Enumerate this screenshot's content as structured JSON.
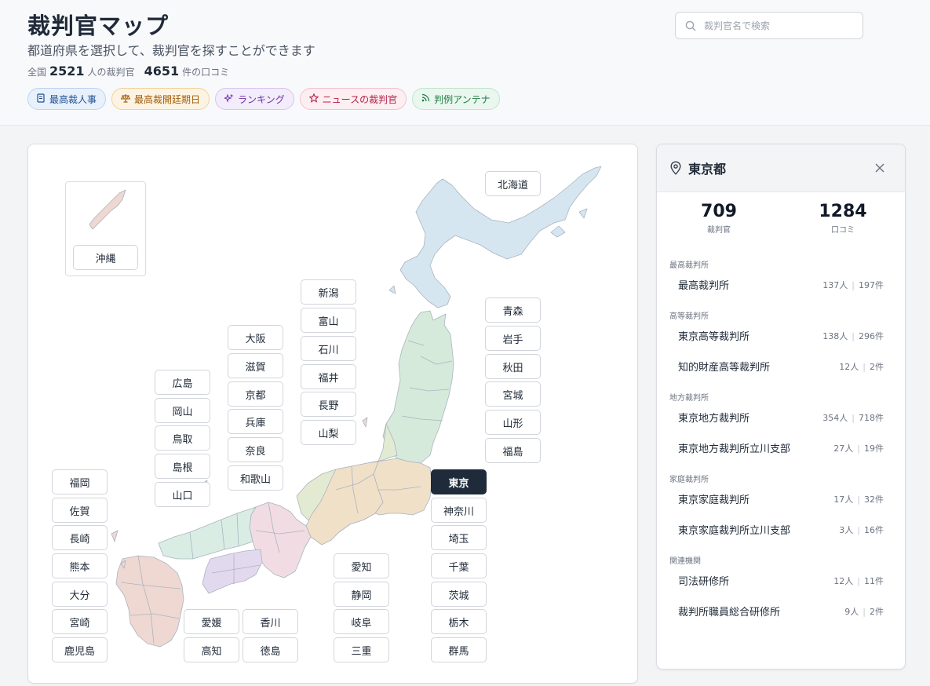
{
  "header": {
    "title": "裁判官マップ",
    "subtitle": "都道府県を選択して、裁判官を探すことができます",
    "stats": {
      "prefix": "全国",
      "judges_count": "2521",
      "judges_suffix": "人の裁判官",
      "reviews_count": "4651",
      "reviews_suffix": "件の口コミ"
    },
    "search_placeholder": "裁判官名で検索",
    "chips": [
      {
        "label": "最高裁人事",
        "icon": "document-icon"
      },
      {
        "label": "最高裁開廷期日",
        "icon": "scale-icon"
      },
      {
        "label": "ランキング",
        "icon": "sparkle-icon"
      },
      {
        "label": "ニュースの裁判官",
        "icon": "star-icon"
      },
      {
        "label": "判例アンテナ",
        "icon": "rss-icon"
      }
    ]
  },
  "map": {
    "selected": "東京",
    "prefectures": {
      "okinawa": "沖縄",
      "hokkaido": "北海道",
      "niigata": "新潟",
      "toyama": "富山",
      "ishikawa": "石川",
      "fukui": "福井",
      "nagano": "長野",
      "yamanashi": "山梨",
      "osaka": "大阪",
      "shiga": "滋賀",
      "kyoto": "京都",
      "hyogo": "兵庫",
      "nara": "奈良",
      "wakayama": "和歌山",
      "hiroshima": "広島",
      "okayama": "岡山",
      "tottori": "鳥取",
      "shimane": "島根",
      "yamaguchi": "山口",
      "aomori": "青森",
      "iwate": "岩手",
      "akita": "秋田",
      "miyagi": "宮城",
      "yamagata": "山形",
      "fukushima": "福島",
      "tokyo": "東京",
      "kanagawa": "神奈川",
      "saitama": "埼玉",
      "chiba": "千葉",
      "ibaraki": "茨城",
      "tochigi": "栃木",
      "gunma": "群馬",
      "aichi": "愛知",
      "shizuoka": "静岡",
      "gifu": "岐阜",
      "mie": "三重",
      "ehime": "愛媛",
      "kagawa": "香川",
      "kochi": "高知",
      "tokushima": "徳島",
      "fukuoka": "福岡",
      "saga": "佐賀",
      "nagasaki": "長崎",
      "kumamoto": "熊本",
      "oita": "大分",
      "miyazaki": "宮崎",
      "kagoshima": "鹿児島"
    },
    "region_colors": {
      "hokkaido": "#d6e6f1",
      "tohoku": "#d5eadb",
      "chubu": "#e3ead2",
      "kanto": "#f1e0c8",
      "kinki": "#f2dce4",
      "chugoku": "#d9ede4",
      "shikoku": "#e3d9ee",
      "kyushu": "#efd8d2"
    }
  },
  "panel": {
    "title": "東京都",
    "judges": "709",
    "judges_label": "裁判官",
    "reviews": "1284",
    "reviews_label": "口コミ",
    "sections": [
      {
        "title": "最高裁判所",
        "courts": [
          {
            "name": "最高裁判所",
            "people": "137人",
            "cases": "197件"
          }
        ]
      },
      {
        "title": "高等裁判所",
        "courts": [
          {
            "name": "東京高等裁判所",
            "people": "138人",
            "cases": "296件"
          },
          {
            "name": "知的財産高等裁判所",
            "people": "12人",
            "cases": "2件"
          }
        ]
      },
      {
        "title": "地方裁判所",
        "courts": [
          {
            "name": "東京地方裁判所",
            "people": "354人",
            "cases": "718件"
          },
          {
            "name": "東京地方裁判所立川支部",
            "people": "27人",
            "cases": "19件"
          }
        ]
      },
      {
        "title": "家庭裁判所",
        "courts": [
          {
            "name": "東京家庭裁判所",
            "people": "17人",
            "cases": "32件"
          },
          {
            "name": "東京家庭裁判所立川支部",
            "people": "3人",
            "cases": "16件"
          }
        ]
      },
      {
        "title": "関連機関",
        "courts": [
          {
            "name": "司法研修所",
            "people": "12人",
            "cases": "11件"
          },
          {
            "name": "裁判所職員総合研修所",
            "people": "9人",
            "cases": "2件"
          }
        ]
      }
    ]
  }
}
